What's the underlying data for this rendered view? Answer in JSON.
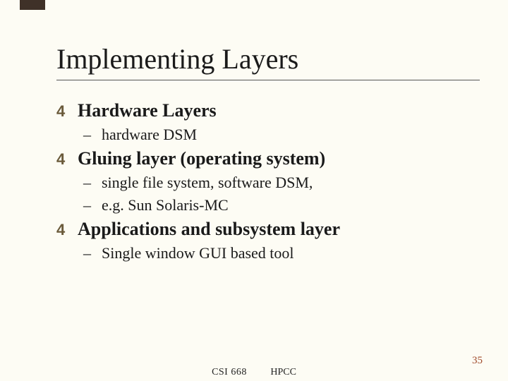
{
  "title": "Implementing Layers",
  "bullets": {
    "b1": {
      "mark": "4",
      "text": "Hardware Layers"
    },
    "b1_1": {
      "mark": "–",
      "text": "hardware DSM"
    },
    "b2": {
      "mark": "4",
      "text": "Gluing layer (operating system)"
    },
    "b2_1": {
      "mark": "–",
      "text": "single file system, software DSM,"
    },
    "b2_2": {
      "mark": "–",
      "text": "e.g. Sun Solaris-MC"
    },
    "b3": {
      "mark": "4",
      "text": "Applications and subsystem layer"
    },
    "b3_1": {
      "mark": "–",
      "text": "Single window GUI based tool"
    }
  },
  "footer": {
    "course": "CSI 668",
    "topic": "HPCC",
    "page": "35"
  }
}
